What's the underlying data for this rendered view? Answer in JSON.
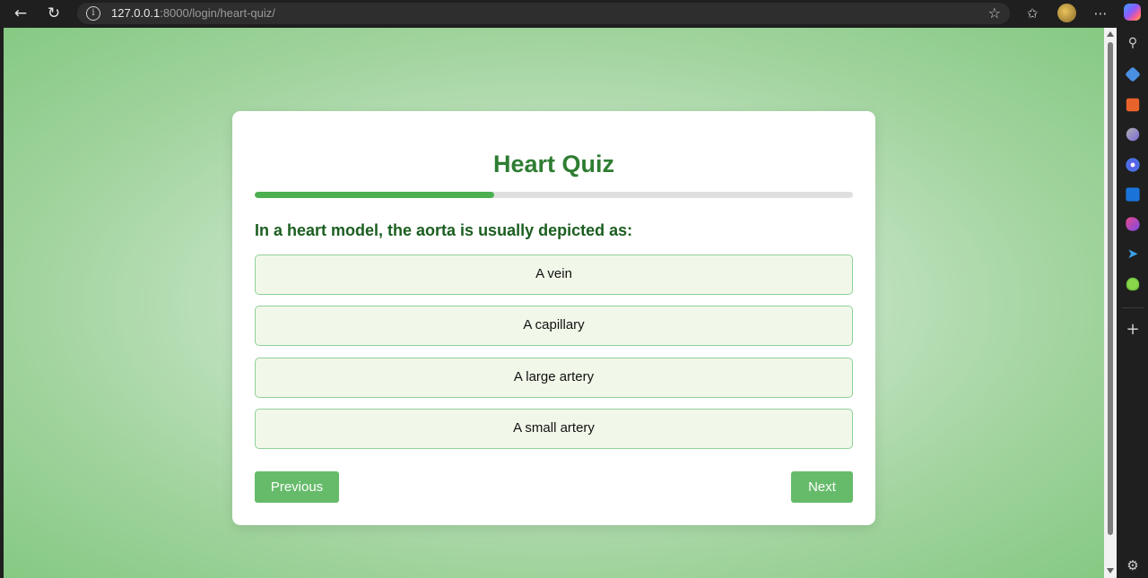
{
  "browser": {
    "url_host": "127.0.0.1",
    "url_rest": ":8000/login/heart-quiz/"
  },
  "quiz": {
    "title": "Heart Quiz",
    "progress_fraction": 0.4,
    "question": "In a heart model, the aorta is usually depicted as:",
    "options": [
      "A vein",
      "A capillary",
      "A large artery",
      "A small artery"
    ],
    "previous_label": "Previous",
    "next_label": "Next"
  },
  "colors": {
    "accent": "#4caf50",
    "title": "#2e7d32",
    "button": "#66bb6a",
    "option_bg": "#f1f8e9"
  }
}
